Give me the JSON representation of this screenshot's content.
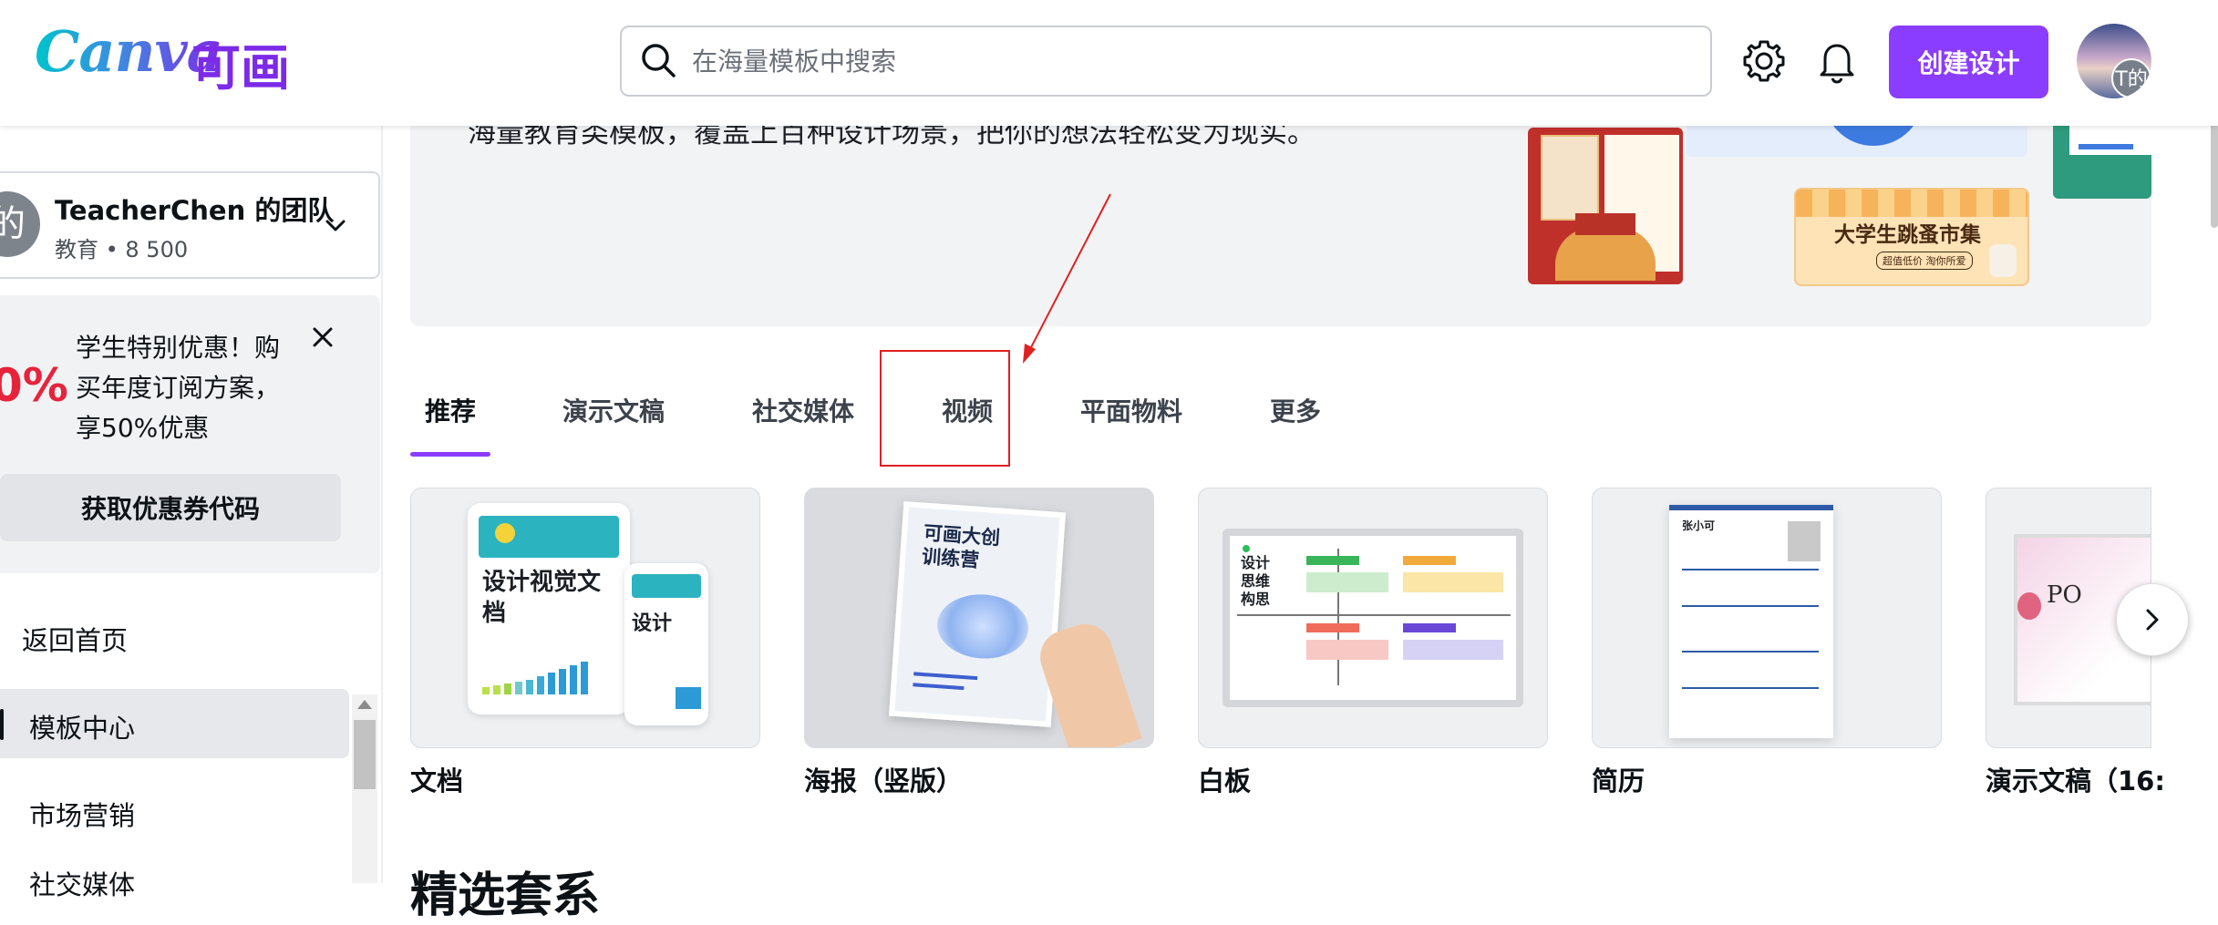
{
  "header": {
    "logo_text": "Canva",
    "logo_cn": "可画",
    "search_placeholder": "在海量模板中搜索",
    "create_button": "创建设计",
    "avatar_initials": "T的"
  },
  "sidebar": {
    "team": {
      "avatar": "的",
      "name": "TeacherChen 的团队",
      "meta": "教育 • 8 500"
    },
    "promo": {
      "percent": "0%",
      "text": "学生特别优惠！购买年度订阅方案，享50%优惠",
      "button": "获取优惠券代码"
    },
    "nav": [
      "返回首页",
      "模板中心",
      "市场营销",
      "社交媒体"
    ]
  },
  "hero": {
    "text": "海量教育类模板，覆盖上百种设计场景，把你的想法轻松变为现实。",
    "poster_title": "大学生跳蚤市集",
    "poster_sub": "超值低价 淘你所爱"
  },
  "tabs": [
    "推荐",
    "演示文稿",
    "社交媒体",
    "视频",
    "平面物料",
    "更多"
  ],
  "cards": [
    {
      "label": "文档",
      "thumb_title": "设计视觉文档"
    },
    {
      "label": "海报（竖版）",
      "thumb_title": "可画大创训练营"
    },
    {
      "label": "白板",
      "thumb_title": "设计思维构思"
    },
    {
      "label": "简历",
      "thumb_title": "张小可"
    },
    {
      "label": "演示文稿（16:",
      "thumb_title": "PO"
    }
  ],
  "section_title": "精选套系",
  "colors": {
    "accent": "#8b3dff",
    "annotation": "#e02020"
  }
}
